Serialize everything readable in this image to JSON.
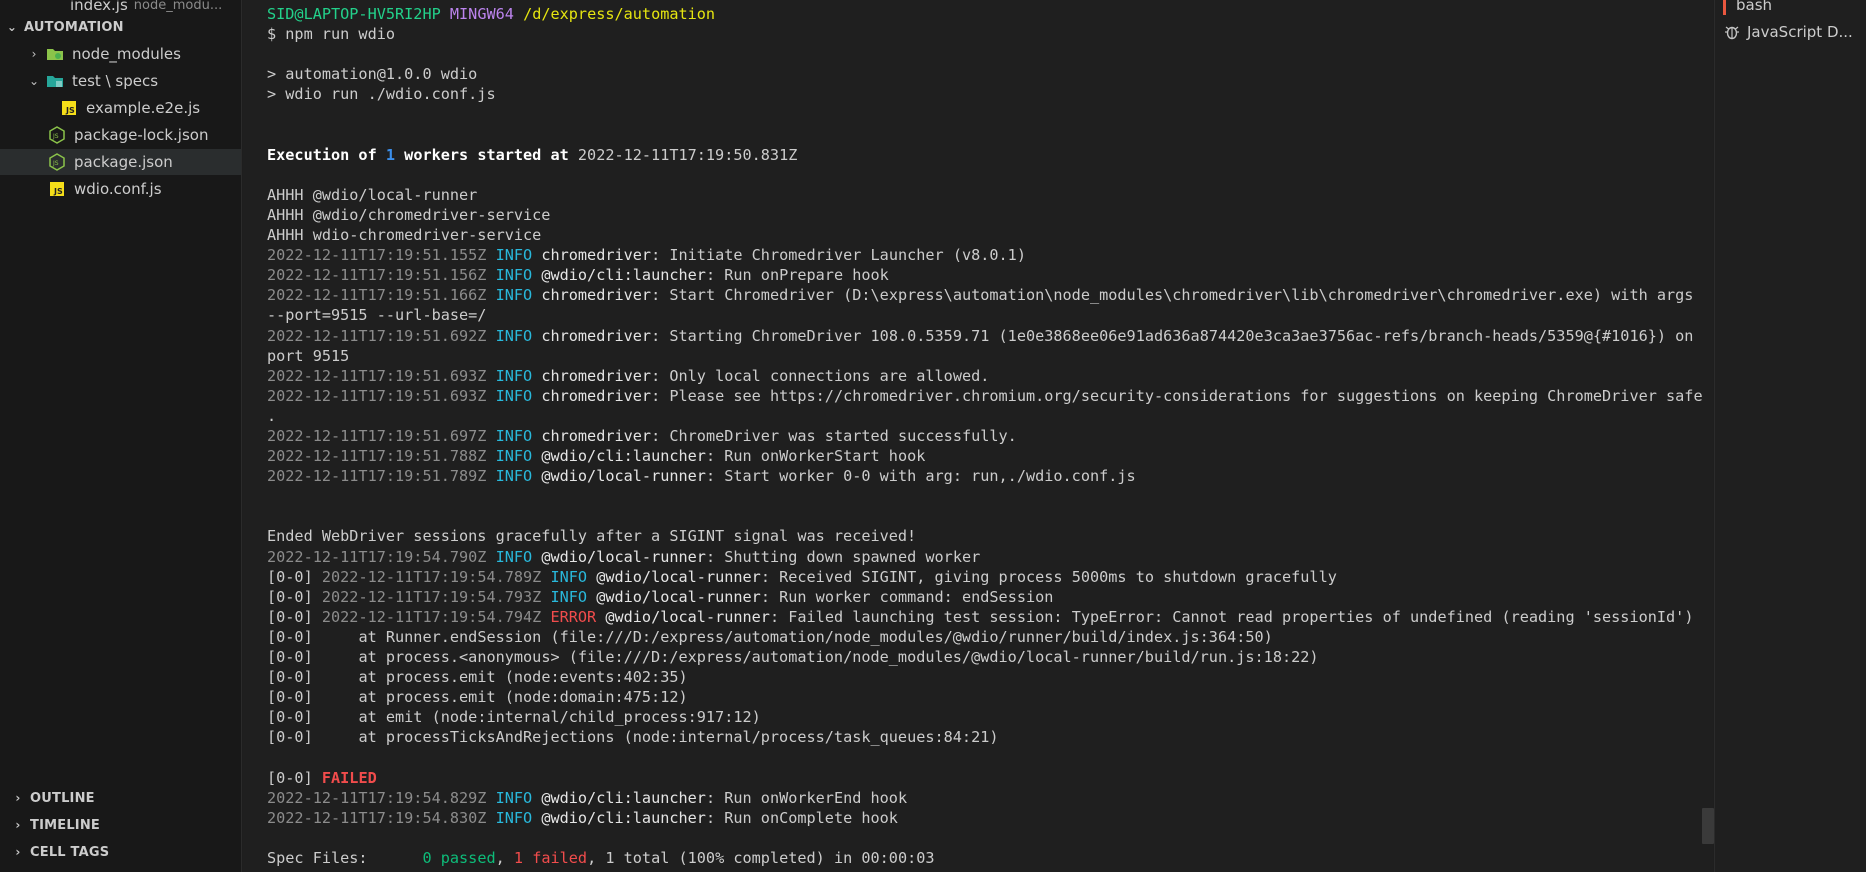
{
  "sidebar": {
    "top_partial": {
      "label": "index.js",
      "hint": "node_modu..."
    },
    "section_title": "AUTOMATION",
    "items": [
      {
        "label": "node_modules",
        "type": "folder",
        "expanded": false
      },
      {
        "label": "test \\ specs",
        "type": "folder",
        "expanded": true
      },
      {
        "label": "example.e2e.js",
        "type": "js-file"
      },
      {
        "label": "package-lock.json",
        "type": "json-file"
      },
      {
        "label": "package.json",
        "type": "json-file",
        "selected": true
      },
      {
        "label": "wdio.conf.js",
        "type": "js-file"
      }
    ],
    "bottom_sections": [
      "OUTLINE",
      "TIMELINE",
      "CELL TAGS"
    ]
  },
  "right_panel": {
    "items": [
      "bash",
      "JavaScript D..."
    ]
  },
  "terminal": {
    "prompt_user": "SID@LAPTOP-HV5RI2HP",
    "prompt_env": "MINGW64",
    "prompt_path": "/d/express/automation",
    "command": "$ npm run wdio",
    "script_line1": "> automation@1.0.0 wdio",
    "script_line2": "> wdio run ./wdio.conf.js",
    "exec_prefix": "Execution of ",
    "exec_count": "1",
    "exec_mid": " workers started at ",
    "exec_time": "2022-12-11T17:19:50.831Z",
    "ahhh": [
      "AHHH @wdio/local-runner",
      "AHHH @wdio/chromedriver-service",
      "AHHH wdio-chromedriver-service"
    ],
    "logs1": [
      {
        "ts": "2022-12-11T17:19:51.155Z",
        "lvl": "INFO",
        "src": "chromedriver",
        "msg": ": Initiate Chromedriver Launcher (v8.0.1)"
      },
      {
        "ts": "2022-12-11T17:19:51.156Z",
        "lvl": "INFO",
        "src": "@wdio/cli:launcher",
        "msg": ": Run onPrepare hook"
      },
      {
        "ts": "2022-12-11T17:19:51.166Z",
        "lvl": "INFO",
        "src": "chromedriver",
        "msg": ": Start Chromedriver (D:\\express\\automation\\node_modules\\chromedriver\\lib\\chromedriver\\chromedriver.exe) with args",
        "cont": "--port=9515 --url-base=/"
      },
      {
        "ts": "2022-12-11T17:19:51.692Z",
        "lvl": "INFO",
        "src": "chromedriver",
        "msg": ": Starting ChromeDriver 108.0.5359.71 (1e0e3868ee06e91ad636a874420e3ca3ae3756ac-refs/branch-heads/5359@{#1016}) on",
        "cont": "port 9515"
      },
      {
        "ts": "2022-12-11T17:19:51.693Z",
        "lvl": "INFO",
        "src": "chromedriver",
        "msg": ": Only local connections are allowed."
      },
      {
        "ts": "2022-12-11T17:19:51.693Z",
        "lvl": "INFO",
        "src": "chromedriver",
        "msg": ": Please see https://chromedriver.chromium.org/security-considerations for suggestions on keeping ChromeDriver safe",
        "cont": "."
      },
      {
        "ts": "2022-12-11T17:19:51.697Z",
        "lvl": "INFO",
        "src": "chromedriver",
        "msg": ": ChromeDriver was started successfully."
      },
      {
        "ts": "2022-12-11T17:19:51.788Z",
        "lvl": "INFO",
        "src": "@wdio/cli:launcher",
        "msg": ": Run onWorkerStart hook"
      },
      {
        "ts": "2022-12-11T17:19:51.789Z",
        "lvl": "INFO",
        "src": "@wdio/local-runner",
        "msg": ": Start worker 0-0 with arg: run,./wdio.conf.js"
      }
    ],
    "sigint_line": "Ended WebDriver sessions gracefully after a SIGINT signal was received!",
    "shutdown": {
      "ts": "2022-12-11T17:19:54.790Z",
      "lvl": "INFO",
      "src": "@wdio/local-runner",
      "msg": ": Shutting down spawned worker"
    },
    "worker_logs": [
      {
        "ts": "2022-12-11T17:19:54.789Z",
        "lvl": "INFO",
        "src": "@wdio/local-runner",
        "msg": ": Received SIGINT, giving process 5000ms to shutdown gracefully"
      },
      {
        "ts": "2022-12-11T17:19:54.793Z",
        "lvl": "INFO",
        "src": "@wdio/local-runner",
        "msg": ": Run worker command: endSession"
      },
      {
        "ts": "2022-12-11T17:19:54.794Z",
        "lvl": "ERROR",
        "src": "@wdio/local-runner",
        "msg": ": Failed launching test session: TypeError: Cannot read properties of undefined (reading 'sessionId')"
      }
    ],
    "worker_tag": "[0-0]",
    "stack": [
      "    at Runner.endSession (file:///D:/express/automation/node_modules/@wdio/runner/build/index.js:364:50)",
      "    at process.<anonymous> (file:///D:/express/automation/node_modules/@wdio/local-runner/build/run.js:18:22)",
      "    at process.emit (node:events:402:35)",
      "    at process.emit (node:domain:475:12)",
      "    at emit (node:internal/child_process:917:12)",
      "    at processTicksAndRejections (node:internal/process/task_queues:84:21)"
    ],
    "failed_label": "FAILED",
    "end_logs": [
      {
        "ts": "2022-12-11T17:19:54.829Z",
        "lvl": "INFO",
        "src": "@wdio/cli:launcher",
        "msg": ": Run onWorkerEnd hook"
      },
      {
        "ts": "2022-12-11T17:19:54.830Z",
        "lvl": "INFO",
        "src": "@wdio/cli:launcher",
        "msg": ": Run onComplete hook"
      }
    ],
    "summary": {
      "prefix": "Spec Files:      ",
      "passed": "0 passed",
      "sep": ", ",
      "failed": "1 failed",
      "rest": ", 1 total (100% completed) in 00:00:03"
    }
  },
  "colors": {
    "background": "#1f1f1f",
    "info": "#29b8db",
    "error": "#f14c4c",
    "passed": "#0dbc79",
    "timestamp": "#8c8c8c"
  }
}
